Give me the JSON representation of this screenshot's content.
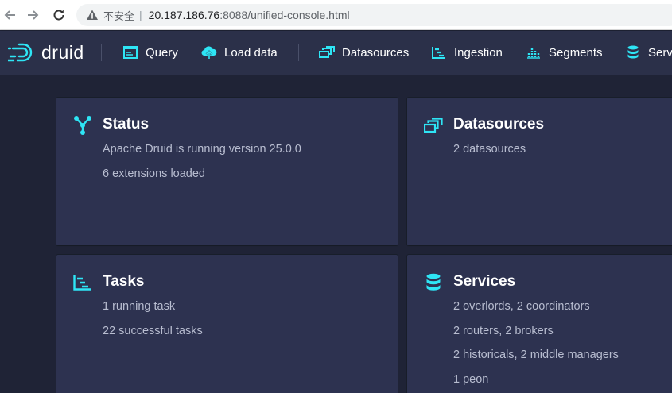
{
  "browser": {
    "security_label": "不安全",
    "url_host": "20.187.186.76",
    "url_rest": ":8088/unified-console.html"
  },
  "header": {
    "logo_text": "druid",
    "nav": [
      {
        "label": "Query",
        "icon": "console-icon"
      },
      {
        "label": "Load data",
        "icon": "cloud-upload-icon"
      },
      {
        "label": "Datasources",
        "icon": "multi-select-icon"
      },
      {
        "label": "Ingestion",
        "icon": "gantt-chart-icon"
      },
      {
        "label": "Segments",
        "icon": "stacked-chart-icon"
      },
      {
        "label": "Serv",
        "icon": "database-icon"
      }
    ]
  },
  "cards": {
    "status": {
      "title": "Status",
      "lines": [
        "Apache Druid is running version 25.0.0",
        "6 extensions loaded"
      ]
    },
    "datasources": {
      "title": "Datasources",
      "lines": [
        "2 datasources"
      ]
    },
    "tasks": {
      "title": "Tasks",
      "lines": [
        "1 running task",
        "22 successful tasks"
      ]
    },
    "services": {
      "title": "Services",
      "lines": [
        "2 overlords, 2 coordinators",
        "2 routers, 2 brokers",
        "2 historicals, 2 middle managers",
        "1 peon"
      ]
    }
  },
  "colors": {
    "accent": "#2ee5f5",
    "header_bg": "#2b3049",
    "card_bg": "#2d3250",
    "page_bg": "#1f2336"
  }
}
